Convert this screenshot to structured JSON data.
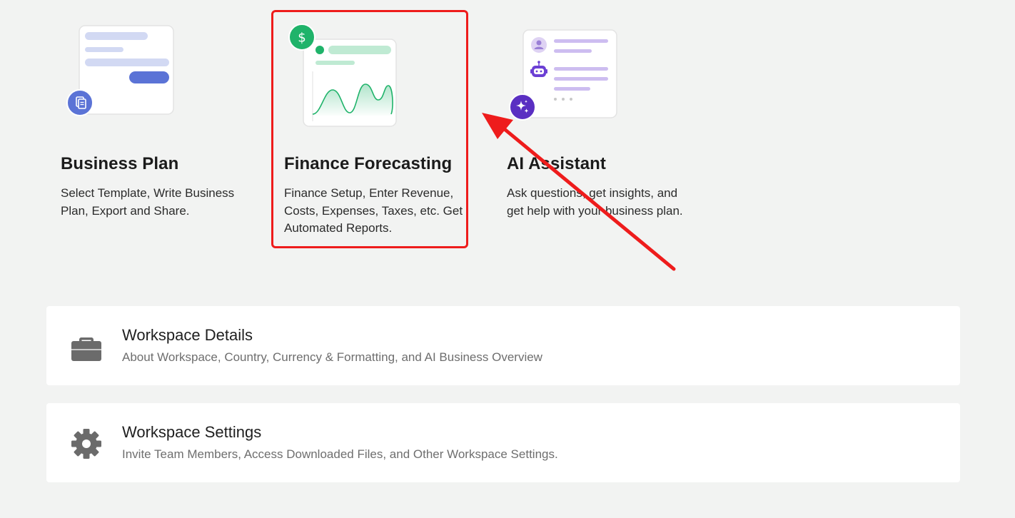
{
  "cards": {
    "business_plan": {
      "title": "Business Plan",
      "description": "Select Template, Write Business Plan, Export and Share."
    },
    "finance_forecasting": {
      "title": "Finance Forecasting",
      "description": "Finance Setup, Enter Revenue, Costs, Expenses, Taxes, etc. Get Automated Reports."
    },
    "ai_assistant": {
      "title": "AI Assistant",
      "description": "Ask questions, get insights, and get help with your business plan."
    }
  },
  "workspace": {
    "details": {
      "title": "Workspace Details",
      "subtitle": "About Workspace, Country, Currency & Formatting, and AI Business Overview"
    },
    "settings": {
      "title": "Workspace Settings",
      "subtitle": "Invite Team Members, Access Downloaded Files, and Other Workspace Settings."
    }
  },
  "icons": {
    "business_plan_badge": "document-icon",
    "finance_badge": "dollar-icon",
    "ai_badge": "sparkle-icon",
    "ai_user": "user-icon",
    "ai_bot": "robot-icon",
    "details": "briefcase-icon",
    "settings": "gear-icon"
  },
  "colors": {
    "background": "#f2f3f2",
    "highlight": "#ee1c1c",
    "finance_green": "#1fb36a",
    "business_blue": "#5b73d6",
    "ai_purple": "#5a2fc2",
    "row_icon": "#6b6b6b"
  }
}
